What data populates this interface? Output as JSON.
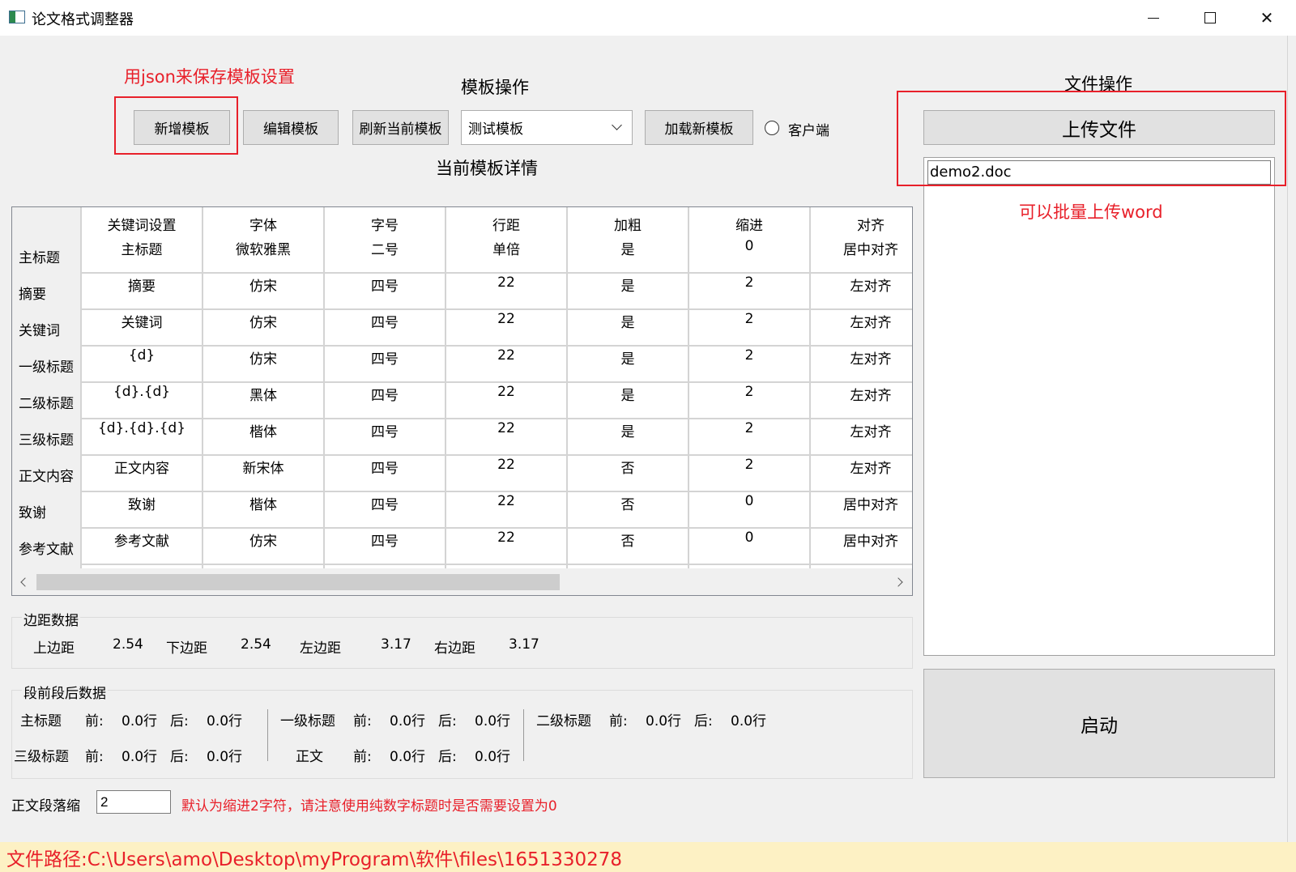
{
  "window": {
    "title": "论文格式调整器",
    "minimize_glyph": "",
    "maximize_glyph": "",
    "close_glyph": "✕"
  },
  "annotations": {
    "json_note": "用json来保存模板设置",
    "batch_note": "可以批量上传word",
    "indent_note": "默认为缩进2字符，请注意使用纯数字标题时是否需要设置为0",
    "color": "#e8202a"
  },
  "template_ops": {
    "title": "模板操作",
    "add_label": "新增模板",
    "edit_label": "编辑模板",
    "refresh_label": "刷新当前模板",
    "template_select": "测试模板",
    "load_label": "加载新模板",
    "client_label": "客户端",
    "details_title": "当前模板详情"
  },
  "table": {
    "columns": [
      "关键词设置",
      "字体",
      "字号",
      "行距",
      "加粗",
      "缩进",
      "对齐"
    ],
    "row_headers": [
      "主标题",
      "摘要",
      "关键词",
      "一级标题",
      "二级标题",
      "三级标题",
      "正文内容",
      "致谢",
      "参考文献"
    ],
    "rows": [
      [
        "主标题",
        "微软雅黑",
        "二号",
        "单倍",
        "是",
        "0",
        "居中对齐"
      ],
      [
        "摘要",
        "仿宋",
        "四号",
        "22",
        "是",
        "2",
        "左对齐"
      ],
      [
        "关键词",
        "仿宋",
        "四号",
        "22",
        "是",
        "2",
        "左对齐"
      ],
      [
        "{d}",
        "仿宋",
        "四号",
        "22",
        "是",
        "2",
        "左对齐"
      ],
      [
        "{d}.{d}",
        "黑体",
        "四号",
        "22",
        "是",
        "2",
        "左对齐"
      ],
      [
        "{d}.{d}.{d}",
        "楷体",
        "四号",
        "22",
        "是",
        "2",
        "左对齐"
      ],
      [
        "正文内容",
        "新宋体",
        "四号",
        "22",
        "否",
        "2",
        "左对齐"
      ],
      [
        "致谢",
        "楷体",
        "四号",
        "22",
        "否",
        "0",
        "居中对齐"
      ],
      [
        "参考文献",
        "仿宋",
        "四号",
        "22",
        "否",
        "0",
        "居中对齐"
      ]
    ]
  },
  "margins": {
    "title": "边距数据",
    "top_label": "上边距",
    "top_value": "2.54",
    "bottom_label": "下边距",
    "bottom_value": "2.54",
    "left_label": "左边距",
    "left_value": "3.17",
    "right_label": "右边距",
    "right_value": "3.17"
  },
  "spacing": {
    "title": "段前段后数据",
    "before_label": "前:",
    "after_label": "后:",
    "items": [
      {
        "name": "主标题",
        "before": "0.0行",
        "after": "0.0行"
      },
      {
        "name": "一级标题",
        "before": "0.0行",
        "after": "0.0行"
      },
      {
        "name": "二级标题",
        "before": "0.0行",
        "after": "0.0行"
      },
      {
        "name": "三级标题",
        "before": "0.0行",
        "after": "0.0行"
      },
      {
        "name": "正文",
        "before": "0.0行",
        "after": "0.0行"
      }
    ]
  },
  "indent": {
    "label": "正文段落缩",
    "value": "2"
  },
  "file_ops": {
    "title": "文件操作",
    "upload_label": "上传文件",
    "files": [
      "demo2.doc"
    ],
    "start_label": "启动"
  },
  "status": {
    "path_text": "文件路径:C:\\Users\\amo\\Desktop\\myProgram\\软件\\files\\1651330278"
  }
}
